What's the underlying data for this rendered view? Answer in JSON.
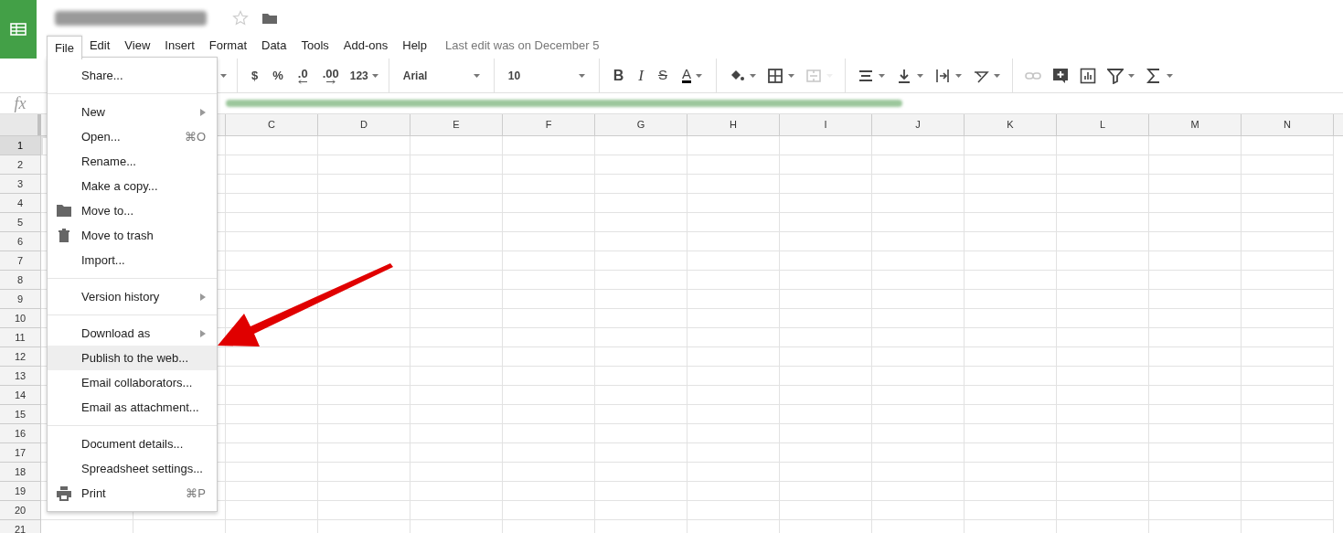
{
  "menubar": [
    {
      "label": "File",
      "selected": true
    },
    {
      "label": "Edit",
      "selected": false
    },
    {
      "label": "View",
      "selected": false
    },
    {
      "label": "Insert",
      "selected": false
    },
    {
      "label": "Format",
      "selected": false
    },
    {
      "label": "Data",
      "selected": false
    },
    {
      "label": "Tools",
      "selected": false
    },
    {
      "label": "Add-ons",
      "selected": false
    },
    {
      "label": "Help",
      "selected": false
    }
  ],
  "last_edit": "Last edit was on December 5",
  "toolbar": [
    {
      "kind": "caret"
    },
    {
      "kind": "sep"
    },
    {
      "kind": "text",
      "label": "$"
    },
    {
      "kind": "text",
      "label": "%"
    },
    {
      "kind": "decdec",
      "label": ".0"
    },
    {
      "kind": "decinc",
      "label": ".00"
    },
    {
      "kind": "dropdown",
      "label": "123"
    },
    {
      "kind": "sep"
    },
    {
      "kind": "select",
      "label": "Arial"
    },
    {
      "kind": "sep"
    },
    {
      "kind": "select",
      "label": "10"
    },
    {
      "kind": "sep"
    },
    {
      "kind": "bold",
      "label": "B",
      "disabled": false
    },
    {
      "kind": "italic",
      "label": "I",
      "disabled": false
    },
    {
      "kind": "strike",
      "label": "S",
      "disabled": false
    },
    {
      "kind": "textcolor",
      "label": "A",
      "disabled": false
    },
    {
      "kind": "sep"
    },
    {
      "kind": "fill",
      "disabled": false
    },
    {
      "kind": "borders",
      "disabled": false
    },
    {
      "kind": "merge",
      "disabled": true
    },
    {
      "kind": "sep"
    },
    {
      "kind": "halign",
      "disabled": false
    },
    {
      "kind": "valign",
      "disabled": false
    },
    {
      "kind": "wrap",
      "disabled": false
    },
    {
      "kind": "rotate",
      "disabled": false
    },
    {
      "kind": "sep"
    },
    {
      "kind": "link",
      "disabled": true
    },
    {
      "kind": "comment",
      "disabled": false
    },
    {
      "kind": "chart",
      "disabled": false
    },
    {
      "kind": "filter",
      "disabled": false
    },
    {
      "kind": "sigma",
      "disabled": false
    }
  ],
  "formula_bar": {
    "label": "fx"
  },
  "columns": [
    "C",
    "D",
    "E",
    "F",
    "G",
    "H",
    "I",
    "J",
    "K",
    "L",
    "M",
    "N"
  ],
  "rows": [
    {
      "label": "1",
      "selected": true
    },
    {
      "label": "2",
      "selected": false
    },
    {
      "label": "3",
      "selected": false
    },
    {
      "label": "4",
      "selected": false
    },
    {
      "label": "5",
      "selected": false
    },
    {
      "label": "6",
      "selected": false
    },
    {
      "label": "7",
      "selected": false
    },
    {
      "label": "8",
      "selected": false
    },
    {
      "label": "9",
      "selected": false
    },
    {
      "label": "10",
      "selected": false
    },
    {
      "label": "11",
      "selected": false
    },
    {
      "label": "12",
      "selected": false
    },
    {
      "label": "13",
      "selected": false
    },
    {
      "label": "14",
      "selected": false
    },
    {
      "label": "15",
      "selected": false
    },
    {
      "label": "16",
      "selected": false
    },
    {
      "label": "17",
      "selected": false
    },
    {
      "label": "18",
      "selected": false
    },
    {
      "label": "19",
      "selected": false
    },
    {
      "label": "20",
      "selected": false
    },
    {
      "label": "21",
      "selected": false
    }
  ],
  "file_menu": [
    [
      {
        "label": "Share...",
        "selected": false
      }
    ],
    [
      {
        "label": "New",
        "submenu": true,
        "selected": false
      },
      {
        "label": "Open...",
        "shortcut": "⌘O",
        "selected": false
      },
      {
        "label": "Rename...",
        "selected": false
      },
      {
        "label": "Make a copy...",
        "selected": false
      },
      {
        "label": "Move to...",
        "kind": "folder",
        "selected": false
      },
      {
        "label": "Move to trash",
        "kind": "trash",
        "selected": false
      },
      {
        "label": "Import...",
        "selected": false
      }
    ],
    [
      {
        "label": "Version history",
        "submenu": true,
        "selected": false
      }
    ],
    [
      {
        "label": "Download as",
        "submenu": true,
        "selected": false
      },
      {
        "label": "Publish to the web...",
        "selected": true
      },
      {
        "label": "Email collaborators...",
        "selected": false
      },
      {
        "label": "Email as attachment...",
        "selected": false
      }
    ],
    [
      {
        "label": "Document details...",
        "selected": false
      },
      {
        "label": "Spreadsheet settings...",
        "selected": false
      },
      {
        "label": "Print",
        "kind": "printer",
        "shortcut": "⌘P",
        "selected": false
      }
    ]
  ]
}
